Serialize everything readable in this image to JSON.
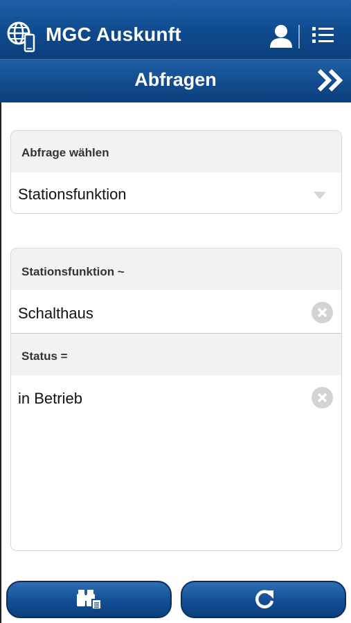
{
  "header": {
    "app_title": "MGC Auskunft",
    "logo_icon": "globe-device-icon",
    "user_icon": "user-icon",
    "menu_icon": "list-menu-icon"
  },
  "subheader": {
    "title": "Abfragen",
    "forward_icon": "double-chevron-right-icon"
  },
  "query_select": {
    "label": "Abfrage wählen",
    "value": "Stationsfunktion",
    "options": [
      "Stationsfunktion"
    ]
  },
  "filters": [
    {
      "label": "Stationsfunktion ~",
      "value": "Schalthaus"
    },
    {
      "label": "Status =",
      "value": "in Betrieb"
    }
  ],
  "buttons": {
    "search_icon": "binoculars-list-icon",
    "reset_icon": "refresh-icon"
  },
  "colors": {
    "header_blue": "#0f4a8e",
    "button_blue": "#134e94",
    "card_header_gray": "#f2f2f2",
    "clear_gray": "#d3d3d3"
  }
}
